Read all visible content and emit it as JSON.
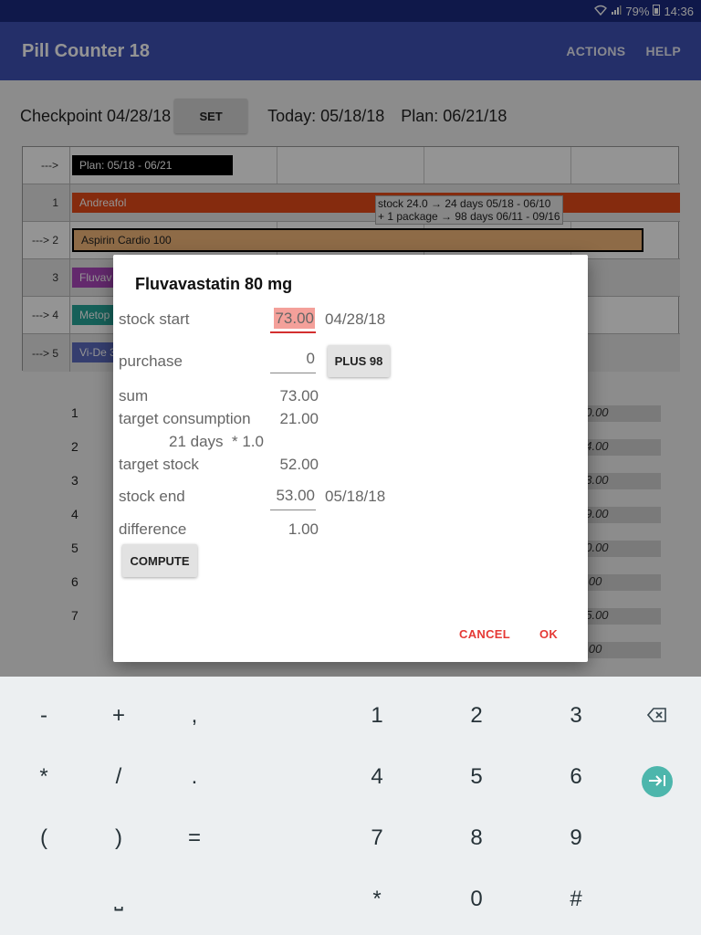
{
  "status_bar": {
    "battery": "79%",
    "time": "14:36"
  },
  "app_bar": {
    "title": "Pill Counter 18",
    "actions": "ACTIONS",
    "help": "HELP"
  },
  "checkpoint": {
    "label": "Checkpoint 04/28/18",
    "set_button": "SET",
    "today": "Today: 05/18/18",
    "plan": "Plan: 06/21/18"
  },
  "grid": {
    "rows": [
      {
        "num": "--->",
        "bar_label": "Plan: 05/18 - 06/21",
        "bar_color": "#000000"
      },
      {
        "num": "1",
        "bar_label": "Andreafol",
        "bar_color": "#e64a19"
      },
      {
        "num": "---> 2",
        "bar_label": "Aspirin Cardio 100",
        "bar_color": "#f5b97a"
      },
      {
        "num": "3",
        "bar_label": "Fluvav",
        "bar_color": "#ab47bc"
      },
      {
        "num": "---> 4",
        "bar_label": "Metop",
        "bar_color": "#26a69a"
      },
      {
        "num": "---> 5",
        "bar_label": "Vi-De 3",
        "bar_color": "#5c6bc0"
      }
    ],
    "tooltip_line1": "stock 24.0 → 24 days 05/18 - 06/10",
    "tooltip_line2": "+ 1 package → 98 days 06/11 - 09/16"
  },
  "lower_rows": [
    {
      "num": "1",
      "value": "30.00"
    },
    {
      "num": "2",
      "value": "24.00"
    },
    {
      "num": "3",
      "value": "53.00"
    },
    {
      "num": "4",
      "value": "19.00"
    },
    {
      "num": "5",
      "value": "00.00"
    },
    {
      "num": "6",
      "value": "8.00"
    },
    {
      "num": "7",
      "value": "05.00"
    },
    {
      "num": "",
      "value": "0.00"
    }
  ],
  "dialog": {
    "title": "Fluvavastatin 80 mg",
    "stock_start_label": "stock start",
    "stock_start_value": "73.00",
    "stock_start_date": "04/28/18",
    "purchase_label": "purchase",
    "purchase_value": "0",
    "plus_button": "PLUS 98",
    "sum_label": "sum",
    "sum_value": "73.00",
    "target_consumption_label": "target consumption",
    "target_consumption_value": "21.00",
    "days_formula": "21 days  * 1.0",
    "target_stock_label": "target stock",
    "target_stock_value": "52.00",
    "stock_end_label": "stock end",
    "stock_end_value": "53.00",
    "stock_end_date": "05/18/18",
    "difference_label": "difference",
    "difference_value": "1.00",
    "compute_button": "COMPUTE",
    "cancel_button": "CANCEL",
    "ok_button": "OK"
  },
  "keyboard": {
    "rows": [
      [
        "-",
        "+",
        ",",
        "1",
        "2",
        "3"
      ],
      [
        "*",
        "/",
        ".",
        "4",
        "5",
        "6"
      ],
      [
        "(",
        ")",
        "=",
        "7",
        "8",
        "9"
      ],
      [
        "⎵",
        "*",
        "0",
        "#"
      ]
    ]
  },
  "colors": {
    "app_bar": "#3f51b5",
    "status_bar": "#1a2a80",
    "accent": "#e53935",
    "go_key": "#4db6ac"
  }
}
